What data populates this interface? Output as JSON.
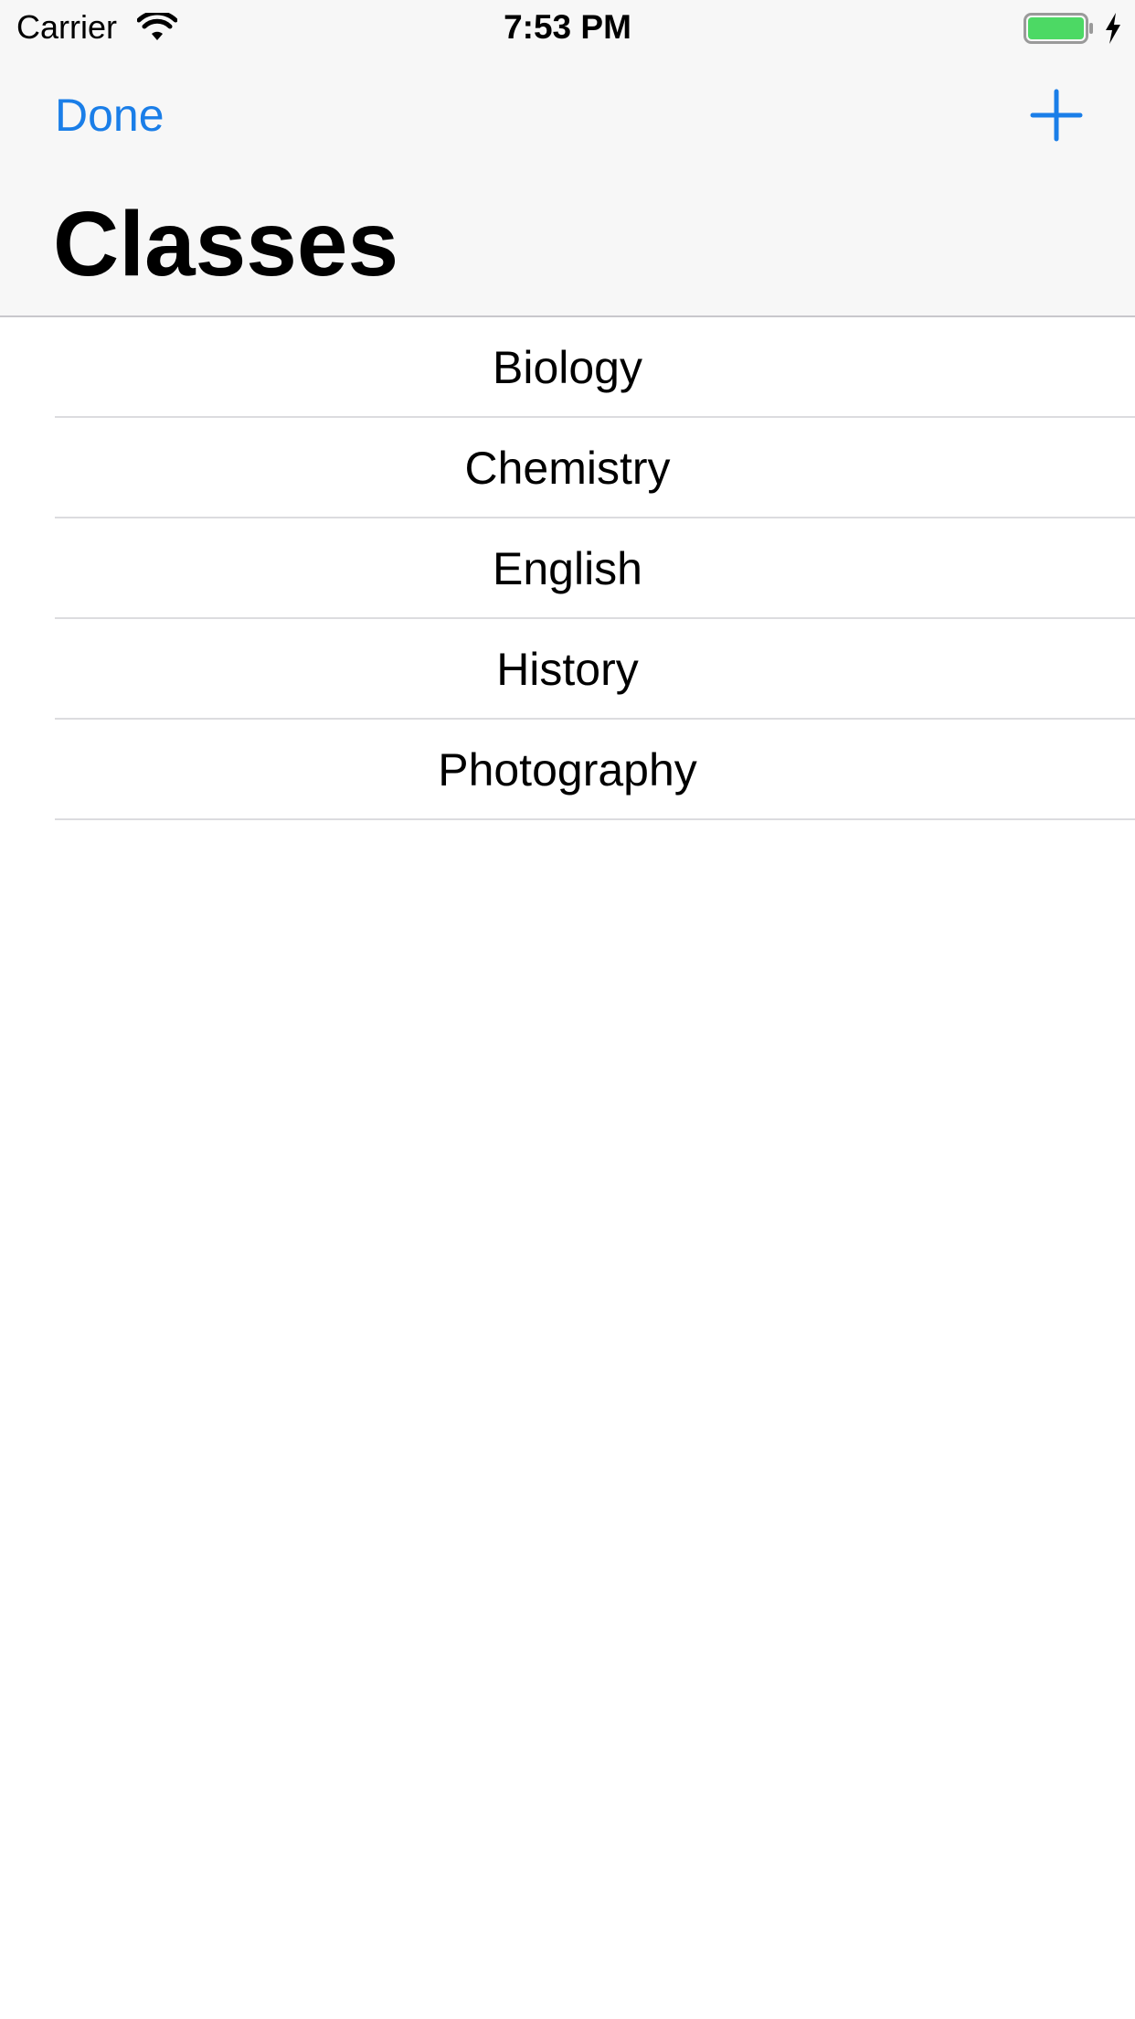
{
  "status_bar": {
    "carrier": "Carrier",
    "time": "7:53 PM",
    "battery_color": "#4cd964"
  },
  "nav": {
    "done_label": "Done",
    "add_icon": "plus-icon",
    "title": "Classes",
    "accent_color": "#1a7ee8"
  },
  "classes": [
    {
      "label": "Biology"
    },
    {
      "label": "Chemistry"
    },
    {
      "label": "English"
    },
    {
      "label": "History"
    },
    {
      "label": "Photography"
    }
  ]
}
